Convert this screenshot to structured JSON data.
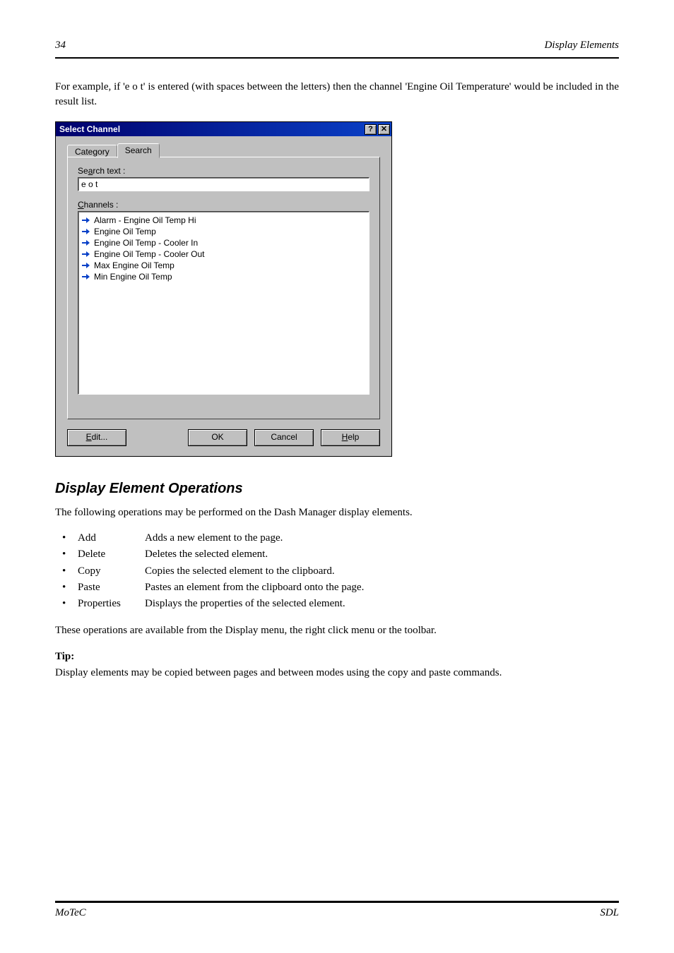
{
  "header": {
    "page_num": "34",
    "section": "Display Elements"
  },
  "intro_para": "For example, if 'e o t' is entered (with spaces between the letters) then the channel 'Engine Oil Temperature' would be included in the result list.",
  "dialog": {
    "title": "Select Channel",
    "tabs": {
      "category": "Category",
      "search": "Search"
    },
    "search_label_prefix": "Se",
    "search_label_u": "a",
    "search_label_suffix": "rch text :",
    "search_value": "e o t",
    "channels_label_u": "C",
    "channels_label_suffix": "hannels :",
    "items": [
      "Alarm - Engine Oil Temp Hi",
      "Engine Oil Temp",
      "Engine Oil Temp - Cooler In",
      "Engine Oil Temp - Cooler Out",
      "Max Engine Oil Temp",
      "Min Engine Oil Temp"
    ],
    "buttons": {
      "edit_u": "E",
      "edit_rest": "dit...",
      "ok": "OK",
      "cancel": "Cancel",
      "help_u": "H",
      "help_rest": "elp"
    }
  },
  "section_ops": {
    "heading": "Display Element Operations",
    "p1": "The following operations may be performed on the Dash Manager display elements.",
    "ops": [
      {
        "label": "Add",
        "desc": "Adds a new element to the page."
      },
      {
        "label": "Delete",
        "desc": "Deletes the selected element."
      },
      {
        "label": "Copy",
        "desc": "Copies the selected element to the clipboard."
      },
      {
        "label": "Paste",
        "desc": "Pastes an element from the clipboard onto the page."
      },
      {
        "label": "Properties",
        "desc": "Displays the properties of the selected element."
      }
    ],
    "p2": "These operations are available from the Display menu, the right click menu or the toolbar.",
    "tip_label": "Tip:",
    "tip_text": "Display elements may be copied between pages and between modes using the copy and paste commands."
  },
  "footer": {
    "company": "MoTeC",
    "product": "SDL"
  }
}
